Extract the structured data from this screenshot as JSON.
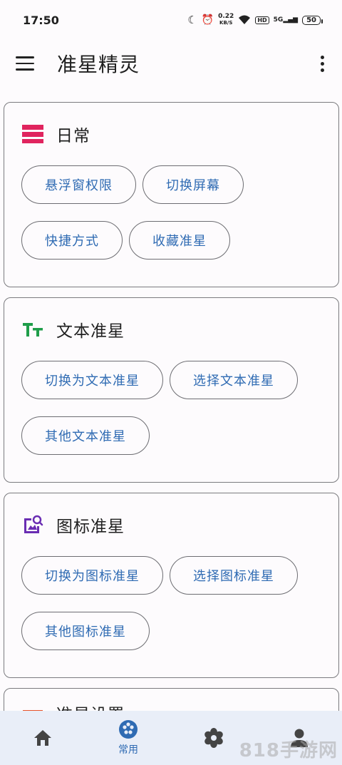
{
  "status_bar": {
    "time": "17:50",
    "net_speed": "0.22",
    "net_unit": "KB/S",
    "hd": "HD",
    "signal": "5G",
    "battery": "50"
  },
  "app_bar": {
    "title": "准星精灵",
    "menu_icon": "menu-icon",
    "more_icon": "more-vert-icon"
  },
  "sections": [
    {
      "title": "日常",
      "icon": "daily-list-icon",
      "icon_color": "#e0245e",
      "buttons": [
        "悬浮窗权限",
        "切换屏幕",
        "快捷方式",
        "收藏准星"
      ]
    },
    {
      "title": "文本准星",
      "icon": "text-size-icon",
      "icon_color": "#1f9d4a",
      "buttons": [
        "切换为文本准星",
        "选择文本准星",
        "其他文本准星"
      ]
    },
    {
      "title": "图标准星",
      "icon": "image-search-icon",
      "icon_color": "#6a2db3",
      "buttons": [
        "切换为图标准星",
        "选择图标准星",
        "其他图标准星"
      ]
    },
    {
      "title": "准星设置",
      "icon": "settings-section-icon",
      "icon_color": "#e8532a",
      "buttons": []
    }
  ],
  "bottom_nav": {
    "items": [
      {
        "label": "",
        "icon": "home-icon"
      },
      {
        "label": "常用",
        "icon": "common-palette-icon"
      },
      {
        "label": "",
        "icon": "flower-settings-icon"
      },
      {
        "label": "",
        "icon": "person-icon"
      }
    ],
    "active_color": "#2f6bb3",
    "inactive_color": "#444444"
  },
  "watermark": "818手游网"
}
